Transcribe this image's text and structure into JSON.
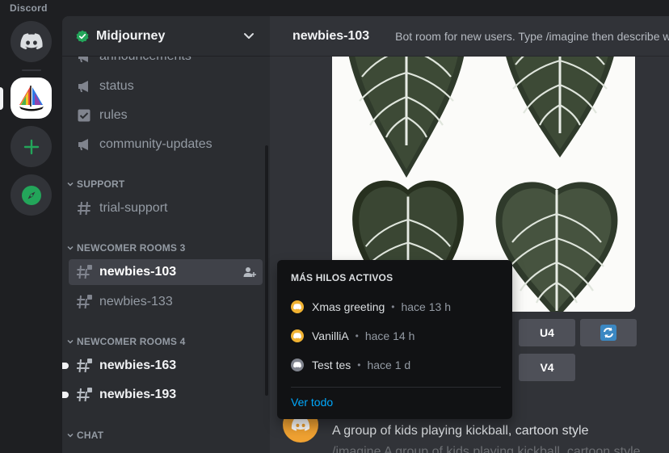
{
  "titlebar": {
    "app_name": "Discord"
  },
  "rail": {
    "servers": [
      {
        "name": "discord-home",
        "icon": "discord-logo-icon"
      },
      {
        "name": "midjourney",
        "icon": "midjourney-boat-icon",
        "active": true
      },
      {
        "name": "add-server",
        "icon": "plus-icon"
      },
      {
        "name": "explore",
        "icon": "compass-icon"
      }
    ],
    "colors": {
      "add": "#23a55a",
      "explore": "#23a55a"
    }
  },
  "sidebar": {
    "server_name": "Midjourney",
    "channels_top": [
      {
        "label": "announcements",
        "icon": "megaphone-icon"
      },
      {
        "label": "status",
        "icon": "megaphone-icon"
      },
      {
        "label": "rules",
        "icon": "checkbox-icon"
      },
      {
        "label": "community-updates",
        "icon": "megaphone-icon"
      }
    ],
    "categories": [
      {
        "label": "SUPPORT",
        "channels": [
          {
            "label": "trial-support"
          }
        ]
      },
      {
        "label": "NEWCOMER ROOMS 3",
        "channels": [
          {
            "label": "newbies-103",
            "active": true
          },
          {
            "label": "newbies-133"
          }
        ]
      },
      {
        "label": "NEWCOMER ROOMS 4",
        "channels": [
          {
            "label": "newbies-163",
            "unread": true
          },
          {
            "label": "newbies-193",
            "unread": true
          }
        ]
      },
      {
        "label": "CHAT",
        "channels": []
      }
    ]
  },
  "main": {
    "channel_name": "newbies-103",
    "topic": "Bot room for new users. Type /imagine then describe what you want to draw.",
    "buttons": {
      "u4": "U4",
      "v4": "V4",
      "reroll_icon": "refresh-icon"
    },
    "message": {
      "prompt": "A group of kids playing kickball, cartoon style",
      "command": "/imagine A group of kids playing kickball, cartoon style"
    }
  },
  "popup": {
    "title": "MÁS HILOS ACTIVOS",
    "threads": [
      {
        "name": "Xmas greeting",
        "time": "hace 13 h",
        "avatar_color": "#f0b232"
      },
      {
        "name": "VanilliA",
        "time": "hace 14 h",
        "avatar_color": "#f0b232"
      },
      {
        "name": "Test tes",
        "time": "hace 1 d",
        "avatar_color": "#80848e"
      }
    ],
    "see_all": "Ver todo"
  }
}
